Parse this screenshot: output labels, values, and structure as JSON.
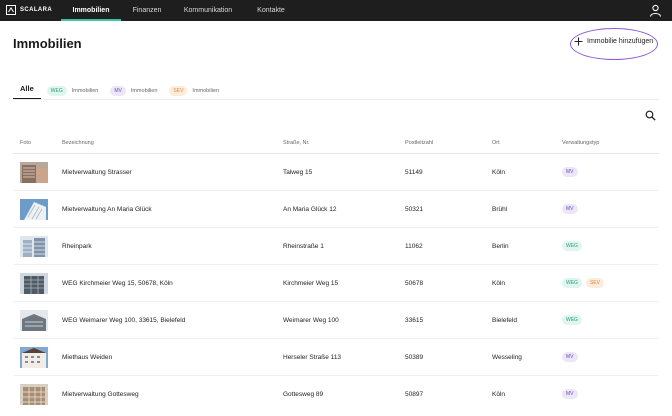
{
  "app": {
    "brand": "SCALARA"
  },
  "nav": {
    "items": [
      {
        "label": "Immobilien",
        "active": true
      },
      {
        "label": "Finanzen",
        "active": false
      },
      {
        "label": "Kommunikation",
        "active": false
      },
      {
        "label": "Kontakte",
        "active": false
      }
    ],
    "user_icon": "user-icon"
  },
  "page": {
    "title": "Immobilien",
    "add_button_label": "Immobilie hinzufügen"
  },
  "filters": {
    "all_label": "Alle",
    "tabs": [
      {
        "badge": "WEG",
        "label": "Immobilien",
        "kind": "weg"
      },
      {
        "badge": "MV",
        "label": "Immobilien",
        "kind": "mv"
      },
      {
        "badge": "SEV",
        "label": "Immobilien",
        "kind": "sev"
      }
    ]
  },
  "table": {
    "columns": [
      "Foto",
      "Bezeichnung",
      "Straße, Nr.",
      "Postleitzahl",
      "Ort",
      "Verwaltungstyp"
    ],
    "rows": [
      {
        "name": "Mietverwaltung Strasser",
        "street": "Talweg 15",
        "zip": "51149",
        "city": "Köln",
        "types": [
          "MV"
        ]
      },
      {
        "name": "Mietverwaltung An Maria Glück",
        "street": "An Maria Glück 12",
        "zip": "50321",
        "city": "Brühl",
        "types": [
          "MV"
        ]
      },
      {
        "name": "Rheinpark",
        "street": "Rheinstraße 1",
        "zip": "11062",
        "city": "Berlin",
        "types": [
          "WEG"
        ]
      },
      {
        "name": "WEG Kirchmeier Weg 15, 50678, Köln",
        "street": "Kirchmeier Weg 15",
        "zip": "50678",
        "city": "Köln",
        "types": [
          "WEG",
          "SEV"
        ]
      },
      {
        "name": "WEG Weimarer Weg 100, 33615, Bielefeld",
        "street": "Weimarer Weg 100",
        "zip": "33615",
        "city": "Bielefeld",
        "types": [
          "WEG"
        ]
      },
      {
        "name": "Miethaus Weiden",
        "street": "Herseler Straße 113",
        "zip": "50389",
        "city": "Wesseling",
        "types": [
          "MV"
        ]
      },
      {
        "name": "Mietverwaltung Gottesweg",
        "street": "Gottesweg 89",
        "zip": "50897",
        "city": "Köln",
        "types": [
          "MV"
        ]
      }
    ]
  },
  "colors": {
    "accent": "#3fc1a5",
    "highlight": "#8e5ad6",
    "weg": "#1f9e7c",
    "mv": "#6b4cb0",
    "sev": "#e0893c"
  }
}
